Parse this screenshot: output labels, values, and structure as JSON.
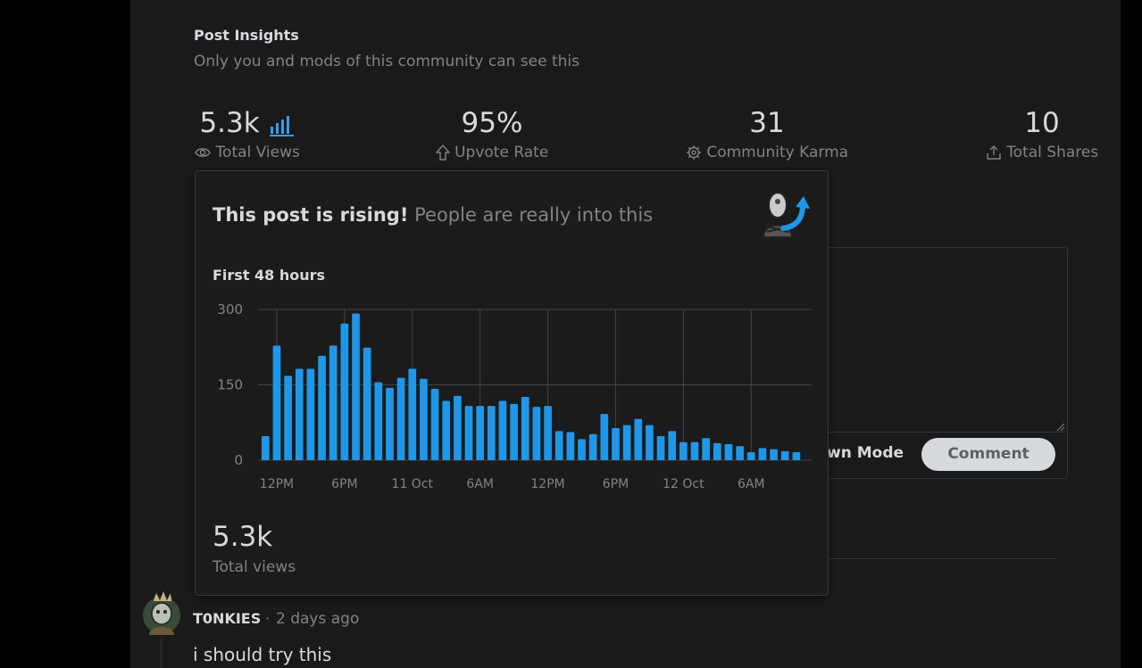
{
  "insights": {
    "title": "Post Insights",
    "subtitle": "Only you and mods of this community can see this"
  },
  "stats": [
    {
      "value": "5.3k",
      "label": "Total Views",
      "icon": "eye-icon"
    },
    {
      "value": "95%",
      "label": "Upvote Rate",
      "icon": "upvote-arrow-icon"
    },
    {
      "value": "31",
      "label": "Community Karma",
      "icon": "karma-gear-icon"
    },
    {
      "value": "10",
      "label": "Total Shares",
      "icon": "share-icon"
    }
  ],
  "popup": {
    "headline_bold": "This post is rising!",
    "headline_rest": "People are really into this",
    "chart_title": "First 48 hours",
    "total_views_value": "5.3k",
    "total_views_label": "Total views"
  },
  "composer": {
    "markdown_mode_label": "wn Mode",
    "comment_button_label": "Comment"
  },
  "comment": {
    "author": "T0NKIES",
    "separator": "·",
    "time": "2 days ago",
    "body": "i should try this"
  },
  "colors": {
    "bar": "#1f97e8",
    "accent_blue": "#3b9be8",
    "background": "#1a1a1b",
    "popup_background": "#1b1b1b"
  },
  "chart_data": {
    "type": "bar",
    "title": "First 48 hours",
    "xlabel": "",
    "ylabel": "",
    "ylim": [
      0,
      300
    ],
    "yticks": [
      0,
      150,
      300
    ],
    "xticks": [
      {
        "label": "12PM",
        "hour": 1
      },
      {
        "label": "6PM",
        "hour": 7
      },
      {
        "label": "11 Oct",
        "hour": 13
      },
      {
        "label": "6AM",
        "hour": 19
      },
      {
        "label": "12PM",
        "hour": 25
      },
      {
        "label": "6PM",
        "hour": 31
      },
      {
        "label": "12 Oct",
        "hour": 37
      },
      {
        "label": "6AM",
        "hour": 43
      }
    ],
    "grid": true,
    "values": [
      48,
      228,
      168,
      182,
      182,
      208,
      228,
      272,
      292,
      224,
      155,
      144,
      164,
      182,
      162,
      142,
      118,
      128,
      108,
      108,
      108,
      118,
      112,
      126,
      106,
      108,
      58,
      56,
      42,
      52,
      92,
      64,
      70,
      82,
      70,
      48,
      58,
      36,
      36,
      44,
      34,
      32,
      28,
      16,
      24,
      22,
      18,
      16
    ]
  }
}
